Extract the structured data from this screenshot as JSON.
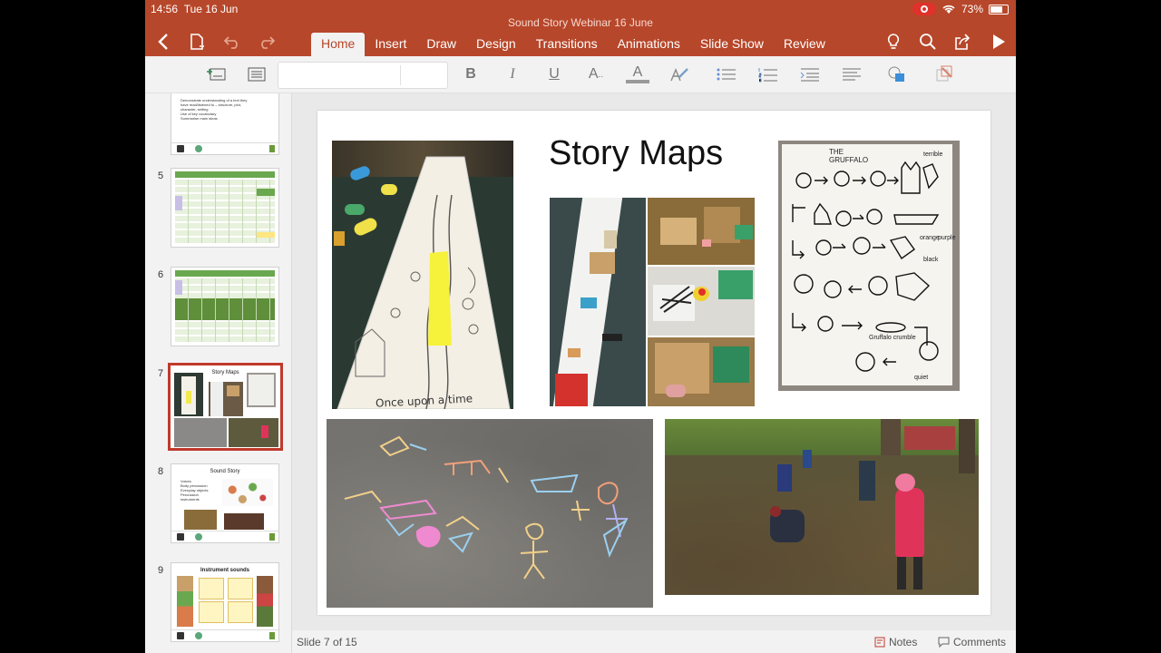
{
  "status": {
    "time": "14:56",
    "date": "Tue 16 Jun",
    "battery": "73%"
  },
  "document": {
    "title": "Sound Story Webinar 16 June"
  },
  "tabs": [
    {
      "label": "Home",
      "active": true
    },
    {
      "label": "Insert"
    },
    {
      "label": "Draw"
    },
    {
      "label": "Design"
    },
    {
      "label": "Transitions"
    },
    {
      "label": "Animations"
    },
    {
      "label": "Slide Show"
    },
    {
      "label": "Review"
    }
  ],
  "ribbon": {
    "font_name": "",
    "font_size": "",
    "bold": "B",
    "italic": "I",
    "underline": "U",
    "text_effects": "A",
    "font_color": "A"
  },
  "thumbnails": [
    {
      "number": "",
      "bullets": [
        "Demonstrate understanding of a text they",
        "have read/listened to – structure, plot,",
        "character, setting",
        "Use of key vocabulary",
        "Summarise main ideas"
      ]
    },
    {
      "number": "5"
    },
    {
      "number": "6"
    },
    {
      "number": "7",
      "title": "Story Maps",
      "selected": true
    },
    {
      "number": "8",
      "title": "Sound Story",
      "bullets": [
        "Voices",
        "Body percussion",
        "Everyday objects",
        "Percussion",
        "instruments"
      ]
    },
    {
      "number": "9",
      "title": "Instrument sounds"
    }
  ],
  "slide": {
    "title": "Story Maps",
    "sketch_labels": {
      "title": "The Gruffalo",
      "terrible": "terrible",
      "orange": "orange",
      "purple": "purple",
      "black": "black",
      "crumble": "Gruffalo crumble",
      "quiet": "quiet"
    },
    "roll_caption": "Once upon a time"
  },
  "footer": {
    "slide_counter": "Slide 7 of 15",
    "notes_label": "Notes",
    "comments_label": "Comments"
  },
  "colors": {
    "accent": "#b7472a",
    "selected": "#c0392b"
  }
}
